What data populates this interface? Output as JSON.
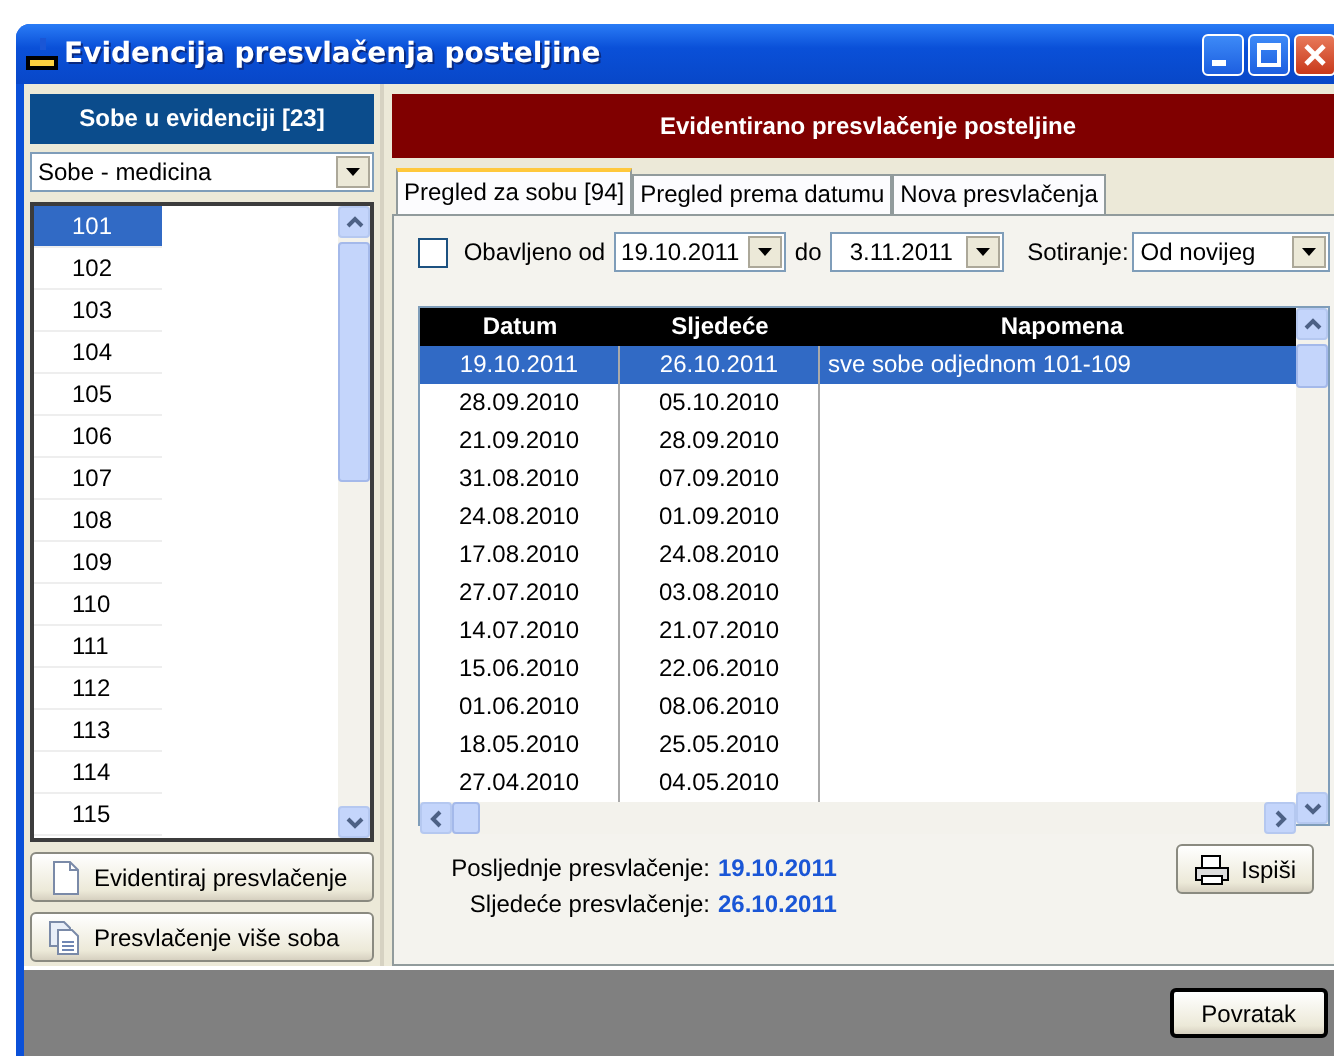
{
  "window": {
    "title": "Evidencija presvlačenja posteljine"
  },
  "rooms_panel": {
    "title": "Sobe u evidenciji [23]",
    "filter": "Sobe - medicina",
    "rooms": [
      {
        "label": "101",
        "selected": true
      },
      {
        "label": "102",
        "selected": false
      },
      {
        "label": "103",
        "selected": false
      },
      {
        "label": "104",
        "selected": false
      },
      {
        "label": "105",
        "selected": false
      },
      {
        "label": "106",
        "selected": false
      },
      {
        "label": "107",
        "selected": false
      },
      {
        "label": "108",
        "selected": false
      },
      {
        "label": "109",
        "selected": false
      },
      {
        "label": "110",
        "selected": false
      },
      {
        "label": "111",
        "selected": false
      },
      {
        "label": "112",
        "selected": false
      },
      {
        "label": "113",
        "selected": false
      },
      {
        "label": "114",
        "selected": false
      },
      {
        "label": "115",
        "selected": false
      }
    ],
    "buttons": [
      {
        "label": "Evidentiraj presvlačenje",
        "kind": "single"
      },
      {
        "label": "Presvlačenje više soba",
        "kind": "multiple"
      }
    ]
  },
  "main_panel": {
    "title": "Evidentirano presvlačenje posteljine",
    "tabs": [
      {
        "label": "Pregled za sobu  [94]",
        "selected": true
      },
      {
        "label": "Pregled prema datumu",
        "selected": false
      },
      {
        "label": "Nova presvlačenja",
        "selected": false
      }
    ],
    "filter": {
      "checkbox_label": "Obavljeno od",
      "checked": false,
      "date_from": "19.10.2011",
      "to_label": "do",
      "date_to": "3.11.2011",
      "sort_label": "Sotiranje:",
      "sort_value": "Od novijeg"
    },
    "table": {
      "columns": [
        "Datum",
        "Sljedeće",
        "Napomena"
      ],
      "rows": [
        {
          "cells": [
            "19.10.2011",
            "26.10.2011",
            "sve sobe odjednom 101-109"
          ],
          "selected": true
        },
        {
          "cells": [
            "28.09.2010",
            "05.10.2010",
            ""
          ],
          "selected": false
        },
        {
          "cells": [
            "21.09.2010",
            "28.09.2010",
            ""
          ],
          "selected": false
        },
        {
          "cells": [
            "31.08.2010",
            "07.09.2010",
            ""
          ],
          "selected": false
        },
        {
          "cells": [
            "24.08.2010",
            "01.09.2010",
            ""
          ],
          "selected": false
        },
        {
          "cells": [
            "17.08.2010",
            "24.08.2010",
            ""
          ],
          "selected": false
        },
        {
          "cells": [
            "27.07.2010",
            "03.08.2010",
            ""
          ],
          "selected": false
        },
        {
          "cells": [
            "14.07.2010",
            "21.07.2010",
            ""
          ],
          "selected": false
        },
        {
          "cells": [
            "15.06.2010",
            "22.06.2010",
            ""
          ],
          "selected": false
        },
        {
          "cells": [
            "01.06.2010",
            "08.06.2010",
            ""
          ],
          "selected": false
        },
        {
          "cells": [
            "18.05.2010",
            "25.05.2010",
            ""
          ],
          "selected": false
        },
        {
          "cells": [
            "27.04.2010",
            "04.05.2010",
            ""
          ],
          "selected": false
        }
      ]
    },
    "summary": [
      {
        "label": "Posljednje presvlačenje:",
        "value": "19.10.2011"
      },
      {
        "label": "Sljedeće presvlačenje:",
        "value": "26.10.2011"
      }
    ],
    "print_button": "Ispiši"
  },
  "footer": {
    "button": "Povratak"
  }
}
